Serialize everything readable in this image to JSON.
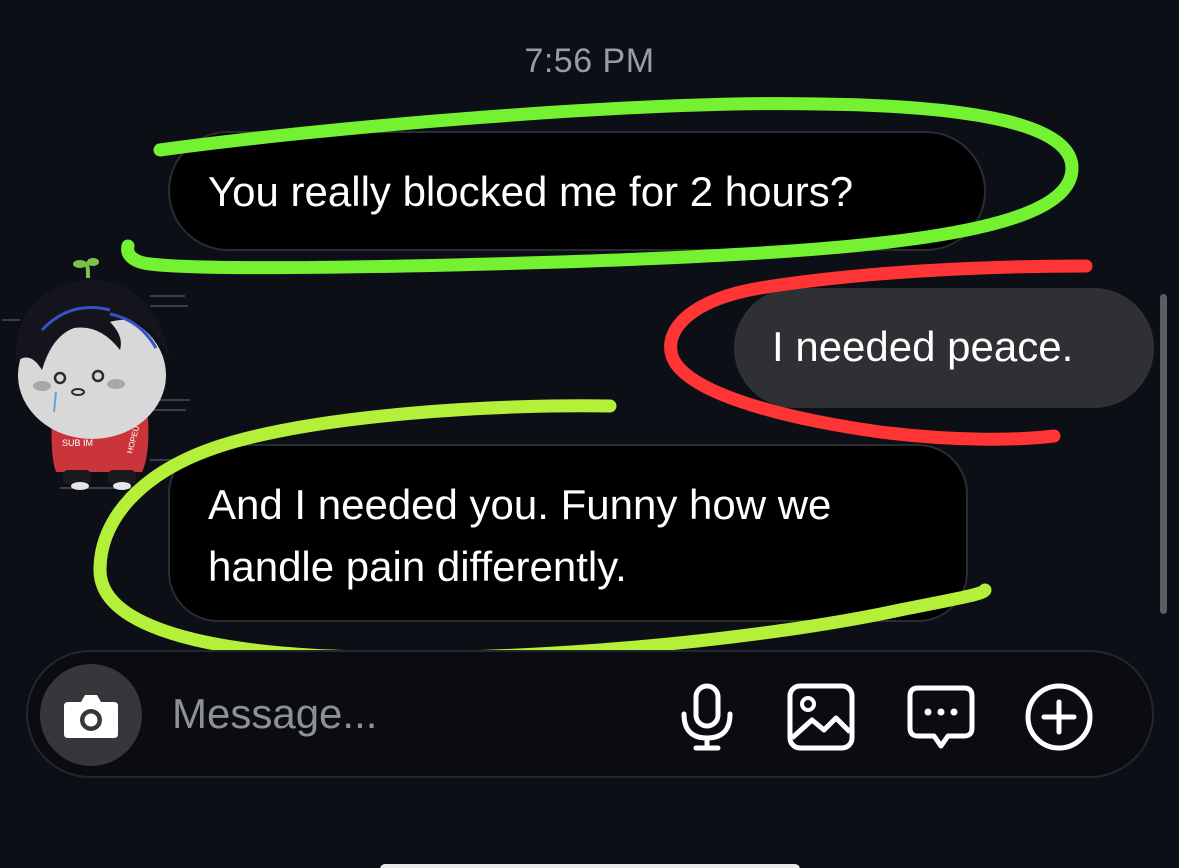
{
  "conversation": {
    "timestamp": "7:56 PM",
    "messages": [
      {
        "direction": "incoming",
        "text": "You really blocked me for 2 hours?"
      },
      {
        "direction": "outgoing",
        "text": "I needed peace."
      },
      {
        "direction": "incoming",
        "lines": [
          "And I needed you. Funny how we",
          "handle pain differently."
        ]
      }
    ]
  },
  "avatar": {
    "icon": "chibi-character-avatar",
    "shirt_text_left": "SUB IM",
    "sleeve_text": "HOPEU"
  },
  "annotations": {
    "highlight_colors": {
      "incoming": "#74f232",
      "outgoing": "#ff3434",
      "incoming_alt": "#b4f03a"
    }
  },
  "composer": {
    "placeholder": "Message...",
    "icons": {
      "camera": "camera-icon",
      "mic": "microphone-icon",
      "gallery": "image-gallery-icon",
      "sticker": "chat-bubble-icon",
      "plus": "plus-circle-icon"
    }
  },
  "theme": {
    "background": "#0c0f16",
    "incoming_bubble": "#000000",
    "outgoing_bubble": "#2f3033",
    "muted_text": "#9a9ca3"
  }
}
